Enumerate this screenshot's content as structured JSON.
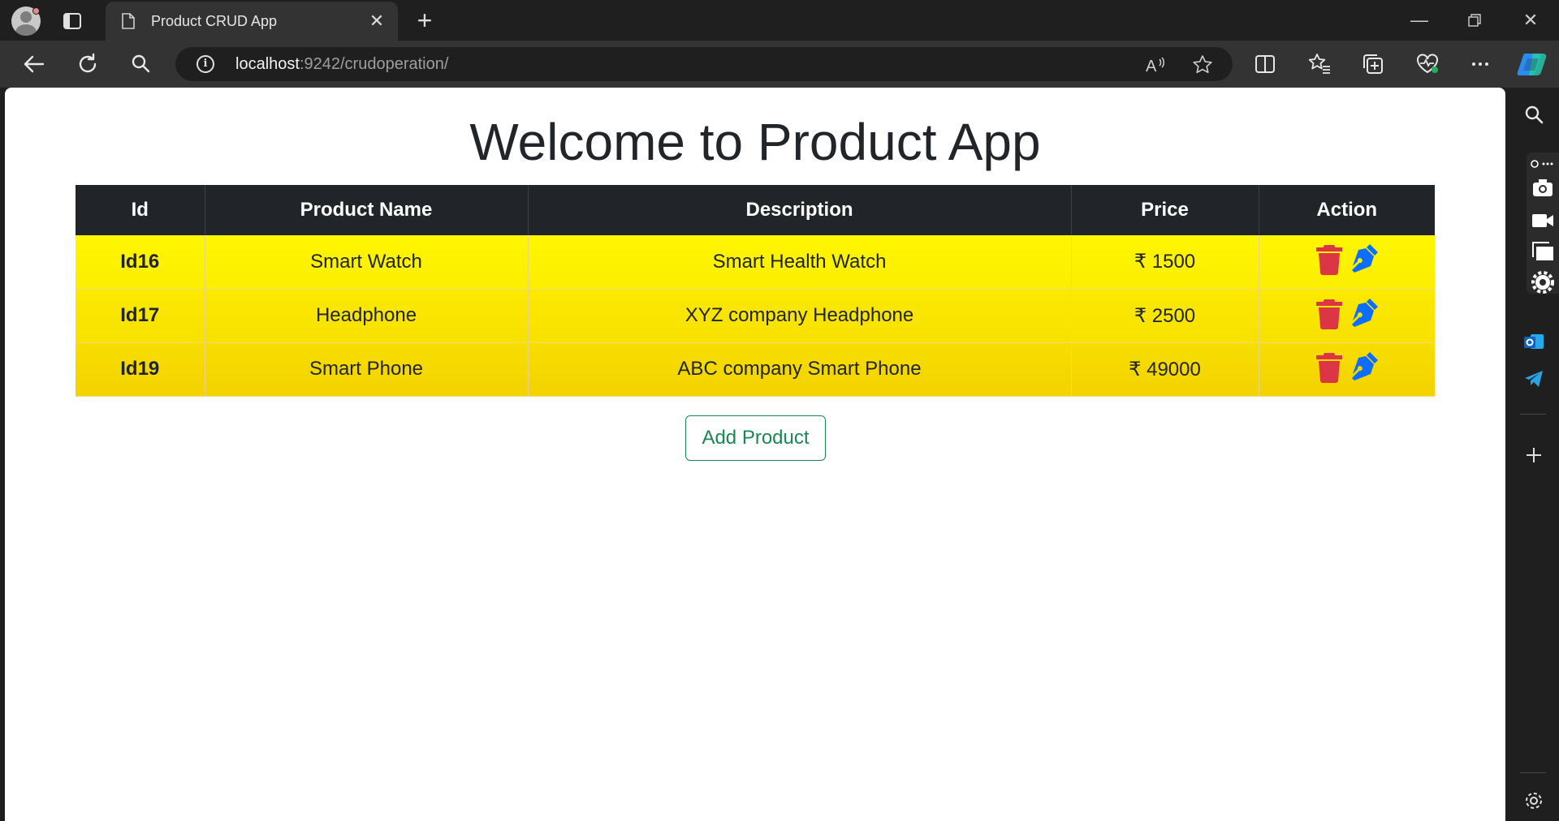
{
  "browser": {
    "tab_title": "Product CRUD App",
    "url_host": "localhost",
    "url_rest": ":9242/crudoperation/"
  },
  "page": {
    "title": "Welcome to Product App",
    "add_button_label": "Add Product"
  },
  "table": {
    "headers": [
      "Id",
      "Product Name",
      "Description",
      "Price",
      "Action"
    ],
    "rows": [
      {
        "id": "Id16",
        "name": "Smart Watch",
        "description": "Smart Health Watch",
        "price": "₹ 1500"
      },
      {
        "id": "Id17",
        "name": "Headphone",
        "description": "XYZ company Headphone",
        "price": "₹ 2500"
      },
      {
        "id": "Id19",
        "name": "Smart Phone",
        "description": "ABC company Smart Phone",
        "price": "₹ 49000"
      }
    ]
  },
  "colors": {
    "header_bg": "#212529",
    "row_yellow": "#fff200",
    "delete_red": "#dc3545",
    "edit_blue": "#0d6efd",
    "add_green": "#198754"
  },
  "icons": {
    "delete": "trash-icon",
    "edit": "pen-nib-icon"
  }
}
